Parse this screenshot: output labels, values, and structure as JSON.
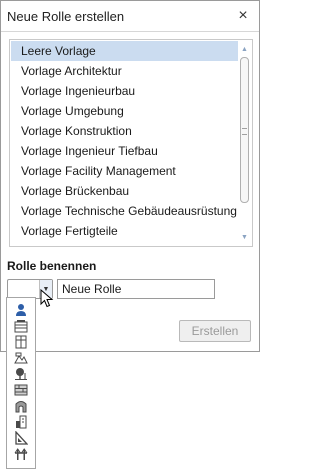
{
  "window": {
    "title": "Neue Rolle erstellen",
    "close_label": "×"
  },
  "template_list": {
    "items": [
      {
        "label": "Leere Vorlage",
        "selected": true
      },
      {
        "label": "Vorlage Architektur",
        "selected": false
      },
      {
        "label": "Vorlage Ingenieurbau",
        "selected": false
      },
      {
        "label": "Vorlage Umgebung",
        "selected": false
      },
      {
        "label": "Vorlage Konstruktion",
        "selected": false
      },
      {
        "label": "Vorlage Ingenieur Tiefbau",
        "selected": false
      },
      {
        "label": "Vorlage Facility Management",
        "selected": false
      },
      {
        "label": "Vorlage Brückenbau",
        "selected": false
      },
      {
        "label": "Vorlage Technische Gebäudeausrüstung",
        "selected": false
      },
      {
        "label": "Vorlage Fertigteile",
        "selected": false
      }
    ],
    "scroll_up": "▲",
    "scroll_down": "▼"
  },
  "role_name": {
    "section_label": "Rolle benennen",
    "icon_combo_arrow": "▼",
    "value": "Neue Rolle"
  },
  "actions": {
    "create_label": "Erstellen"
  },
  "icon_options": [
    "person-icon",
    "building-stack-icon",
    "panel-icon",
    "terrain-icon",
    "tree-icon",
    "wall-icon",
    "arch-icon",
    "facility-icon",
    "triangle-ruler-icon",
    "bridge-icon"
  ],
  "colors": {
    "selection": "#cbdcf0",
    "icon_blue": "#2d5ea8",
    "icon_gray": "#4a4a4a"
  }
}
